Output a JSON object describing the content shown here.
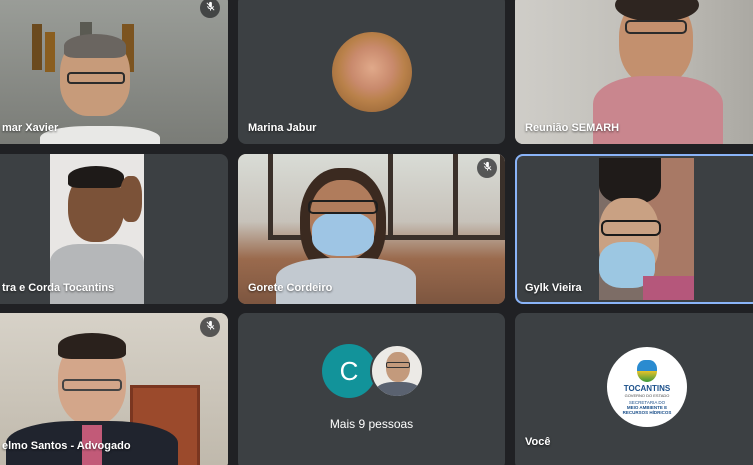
{
  "participants": [
    {
      "name": "mar Xavier",
      "muted": true
    },
    {
      "name": "Marina Jabur",
      "muted": false
    },
    {
      "name": "Reunião SEMARH",
      "muted": false
    },
    {
      "name": "tra e Corda Tocantins",
      "muted": false
    },
    {
      "name": "Gorete Cordeiro",
      "muted": true
    },
    {
      "name": "Gylk Vieira",
      "muted": false,
      "active_speaker": true
    },
    {
      "name": "elmo Santos - Advogado",
      "muted": true
    },
    {
      "name": "Você",
      "muted": false
    }
  ],
  "more_people": {
    "label": "Mais 9 pessoas",
    "avatar_letter": "C"
  },
  "logo": {
    "title": "TOCANTINS",
    "subtitle": "GOVERNO DO ESTADO",
    "line1": "SECRETARIA DO",
    "line2": "MEIO AMBIENTE E",
    "line3": "RECURSOS HÍDRICOS"
  },
  "colors": {
    "accent": "#8ab4f8",
    "tile_bg": "#3c4043",
    "page_bg": "#202124",
    "avatar_c": "#12939a"
  },
  "icons": [
    "mic-off-icon"
  ]
}
